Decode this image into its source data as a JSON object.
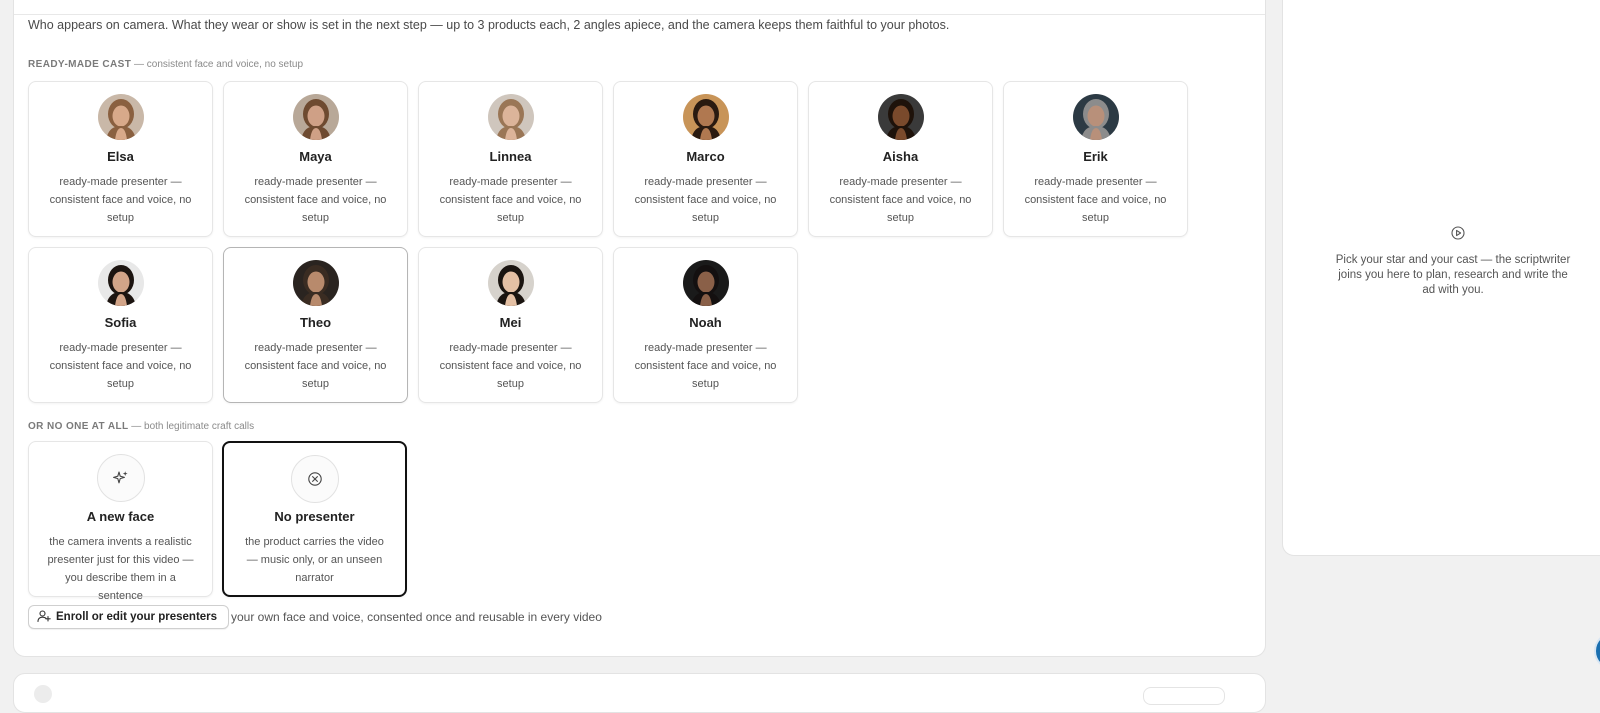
{
  "intro_text": "Who appears on camera. What they wear or show is set in the next step — up to 3 products each, 2 angles apiece, and the camera keeps them faithful to your photos.",
  "cast_section": {
    "label": "READY-MADE CAST",
    "sublabel": "— consistent face and voice, no setup",
    "presenters": [
      {
        "name": "Elsa",
        "desc": "ready-made presenter — consistent face and voice, no setup",
        "skin": "#d8a98a",
        "hair": "#8a6040",
        "bg": "#c9b8a8",
        "state": "default"
      },
      {
        "name": "Maya",
        "desc": "ready-made presenter — consistent face and voice, no setup",
        "skin": "#cfa086",
        "hair": "#6e4a30",
        "bg": "#b8a898",
        "state": "default"
      },
      {
        "name": "Linnea",
        "desc": "ready-made presenter — consistent face and voice, no setup",
        "skin": "#dcb49a",
        "hair": "#9a7656",
        "bg": "#cfc6bd",
        "state": "default"
      },
      {
        "name": "Marco",
        "desc": "ready-made presenter — consistent face and voice, no setup",
        "skin": "#b07850",
        "hair": "#2a1a10",
        "bg": "#c89458",
        "state": "default"
      },
      {
        "name": "Aisha",
        "desc": "ready-made presenter — consistent face and voice, no setup",
        "skin": "#7a4a2c",
        "hair": "#1e120a",
        "bg": "#3a3a3a",
        "state": "default"
      },
      {
        "name": "Erik",
        "desc": "ready-made presenter — consistent face and voice, no setup",
        "skin": "#b8907a",
        "hair": "#8c8c8c",
        "bg": "#2c3a44",
        "state": "default"
      },
      {
        "name": "Sofia",
        "desc": "ready-made presenter — consistent face and voice, no setup",
        "skin": "#d2a488",
        "hair": "#1c1410",
        "bg": "#e8e8e8",
        "state": "default"
      },
      {
        "name": "Theo",
        "desc": "ready-made presenter — consistent face and voice, no setup",
        "skin": "#b88a6c",
        "hair": "#3a2c22",
        "bg": "#2a2420",
        "state": "hover"
      },
      {
        "name": "Mei",
        "desc": "ready-made presenter — consistent face and voice, no setup",
        "skin": "#e4c0a4",
        "hair": "#1a1410",
        "bg": "#d6d2cc",
        "state": "default"
      },
      {
        "name": "Noah",
        "desc": "ready-made presenter — consistent face and voice, no setup",
        "skin": "#8a6048",
        "hair": "#141010",
        "bg": "#1a1a1a",
        "state": "default"
      }
    ]
  },
  "none_section": {
    "label": "OR NO ONE AT ALL",
    "sublabel": "— both legitimate craft calls",
    "options": [
      {
        "name": "A new face",
        "desc": "the camera invents a realistic presenter just for this video — you describe them in a sentence",
        "icon": "sparkle-icon",
        "state": "default"
      },
      {
        "name": "No presenter",
        "desc": "the product carries the video — music only, or an unseen narrator",
        "icon": "circle-x-icon",
        "state": "selected"
      }
    ]
  },
  "enroll": {
    "button_label": "Enroll or edit your presenters",
    "note": "your own face and voice, consented once and reusable in every video"
  },
  "side_panel": {
    "text": "Pick your star and your cast — the scriptwriter joins you here to plan, research and write the ad with you."
  }
}
